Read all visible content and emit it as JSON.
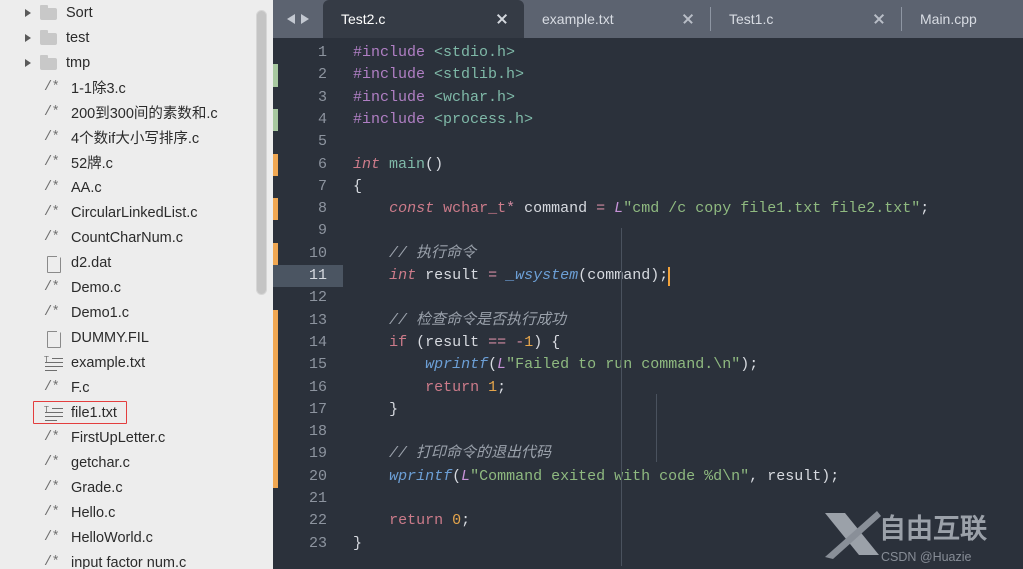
{
  "sidebar": {
    "scrollbar": {
      "name": "vertical-scrollbar"
    },
    "selected_item": "file1.txt",
    "items": [
      {
        "label": "Sort",
        "icon": "folder-icon",
        "type": "folder",
        "expandable": true
      },
      {
        "label": "test",
        "icon": "folder-icon",
        "type": "folder",
        "expandable": true
      },
      {
        "label": "tmp",
        "icon": "folder-icon",
        "type": "folder",
        "expandable": true
      },
      {
        "label": "1-1除3.c",
        "icon": "c-source-icon",
        "type": "file"
      },
      {
        "label": "200到300间的素数和.c",
        "icon": "c-source-icon",
        "type": "file"
      },
      {
        "label": "4个数if大小写排序.c",
        "icon": "c-source-icon",
        "type": "file"
      },
      {
        "label": "52牌.c",
        "icon": "c-source-icon",
        "type": "file"
      },
      {
        "label": "AA.c",
        "icon": "c-source-icon",
        "type": "file"
      },
      {
        "label": "CircularLinkedList.c",
        "icon": "c-source-icon",
        "type": "file"
      },
      {
        "label": "CountCharNum.c",
        "icon": "c-source-icon",
        "type": "file"
      },
      {
        "label": "d2.dat",
        "icon": "page-icon",
        "type": "file"
      },
      {
        "label": "Demo.c",
        "icon": "c-source-icon",
        "type": "file"
      },
      {
        "label": "Demo1.c",
        "icon": "c-source-icon",
        "type": "file"
      },
      {
        "label": "DUMMY.FIL",
        "icon": "page-icon",
        "type": "file"
      },
      {
        "label": "example.txt",
        "icon": "text-file-icon",
        "type": "file"
      },
      {
        "label": "F.c",
        "icon": "c-source-icon",
        "type": "file"
      },
      {
        "label": "file1.txt",
        "icon": "text-file-icon",
        "type": "file",
        "selected": true
      },
      {
        "label": "FirstUpLetter.c",
        "icon": "c-source-icon",
        "type": "file"
      },
      {
        "label": "getchar.c",
        "icon": "c-source-icon",
        "type": "file"
      },
      {
        "label": "Grade.c",
        "icon": "c-source-icon",
        "type": "file"
      },
      {
        "label": "Hello.c",
        "icon": "c-source-icon",
        "type": "file"
      },
      {
        "label": "HelloWorld.c",
        "icon": "c-source-icon",
        "type": "file"
      },
      {
        "label": "input factor num.c",
        "icon": "c-source-icon",
        "type": "file"
      }
    ]
  },
  "tabbar": {
    "nav_prev": "prev-tab-arrow",
    "nav_next": "next-tab-arrow",
    "tabs": [
      {
        "label": "Test2.c",
        "active": true,
        "closable": true
      },
      {
        "label": "example.txt",
        "active": false,
        "closable": true
      },
      {
        "label": "Test1.c",
        "active": false,
        "closable": true
      },
      {
        "label": "Main.cpp",
        "active": false,
        "closable": false
      }
    ]
  },
  "editor": {
    "active_line": 11,
    "caret": {
      "line": 11,
      "column": 32
    },
    "colors": {
      "background": "#2b313b",
      "gutter_text": "#8d949f",
      "active_line_gutter": "#4b5562",
      "change_added": "#a8c8a0",
      "change_modified": "#f0a752",
      "accent_caret": "#f2a33c",
      "keyword": "#cc7b8a",
      "preprocessor": "#b07fc4",
      "string": "#8fba80",
      "comment": "#9aa1ab",
      "number": "#e5a54b",
      "function": "#6c9fd6",
      "type": "#7fb9a8"
    },
    "line_numbers": [
      "1",
      "2",
      "3",
      "4",
      "5",
      "6",
      "7",
      "8",
      "9",
      "10",
      "11",
      "12",
      "13",
      "14",
      "15",
      "16",
      "17",
      "18",
      "19",
      "20",
      "21",
      "22",
      "23"
    ],
    "lines": [
      {
        "n": 1,
        "text": "#include <stdio.h>"
      },
      {
        "n": 2,
        "text": "#include <stdlib.h>"
      },
      {
        "n": 3,
        "text": "#include <wchar.h>"
      },
      {
        "n": 4,
        "text": "#include <process.h>"
      },
      {
        "n": 5,
        "text": ""
      },
      {
        "n": 6,
        "text": "int main()"
      },
      {
        "n": 7,
        "text": "{"
      },
      {
        "n": 8,
        "text": "    const wchar_t* command = L\"cmd /c copy file1.txt file2.txt\";"
      },
      {
        "n": 9,
        "text": ""
      },
      {
        "n": 10,
        "text": "    // 执行命令"
      },
      {
        "n": 11,
        "text": "    int result = _wsystem(command);"
      },
      {
        "n": 12,
        "text": ""
      },
      {
        "n": 13,
        "text": "    // 检查命令是否执行成功"
      },
      {
        "n": 14,
        "text": "    if (result == -1) {"
      },
      {
        "n": 15,
        "text": "        wprintf(L\"Failed to run command.\\n\");"
      },
      {
        "n": 16,
        "text": "        return 1;"
      },
      {
        "n": 17,
        "text": "    }"
      },
      {
        "n": 18,
        "text": ""
      },
      {
        "n": 19,
        "text": "    // 打印命令的退出代码"
      },
      {
        "n": 20,
        "text": "    wprintf(L\"Command exited with code %d\\n\", result);"
      },
      {
        "n": 21,
        "text": ""
      },
      {
        "n": 22,
        "text": "    return 0;"
      },
      {
        "n": 23,
        "text": "}"
      }
    ],
    "change_markers": [
      {
        "from_line": 2,
        "to_line": 2,
        "kind": "added"
      },
      {
        "from_line": 4,
        "to_line": 4,
        "kind": "added"
      },
      {
        "from_line": 6,
        "to_line": 6,
        "kind": "modified"
      },
      {
        "from_line": 8,
        "to_line": 8,
        "kind": "modified"
      },
      {
        "from_line": 10,
        "to_line": 11,
        "kind": "modified"
      },
      {
        "from_line": 13,
        "to_line": 20,
        "kind": "modified"
      }
    ]
  },
  "watermark": {
    "logo": "x-logo-icon",
    "brand": "自由互联",
    "credit": "CSDN @Huazie"
  }
}
